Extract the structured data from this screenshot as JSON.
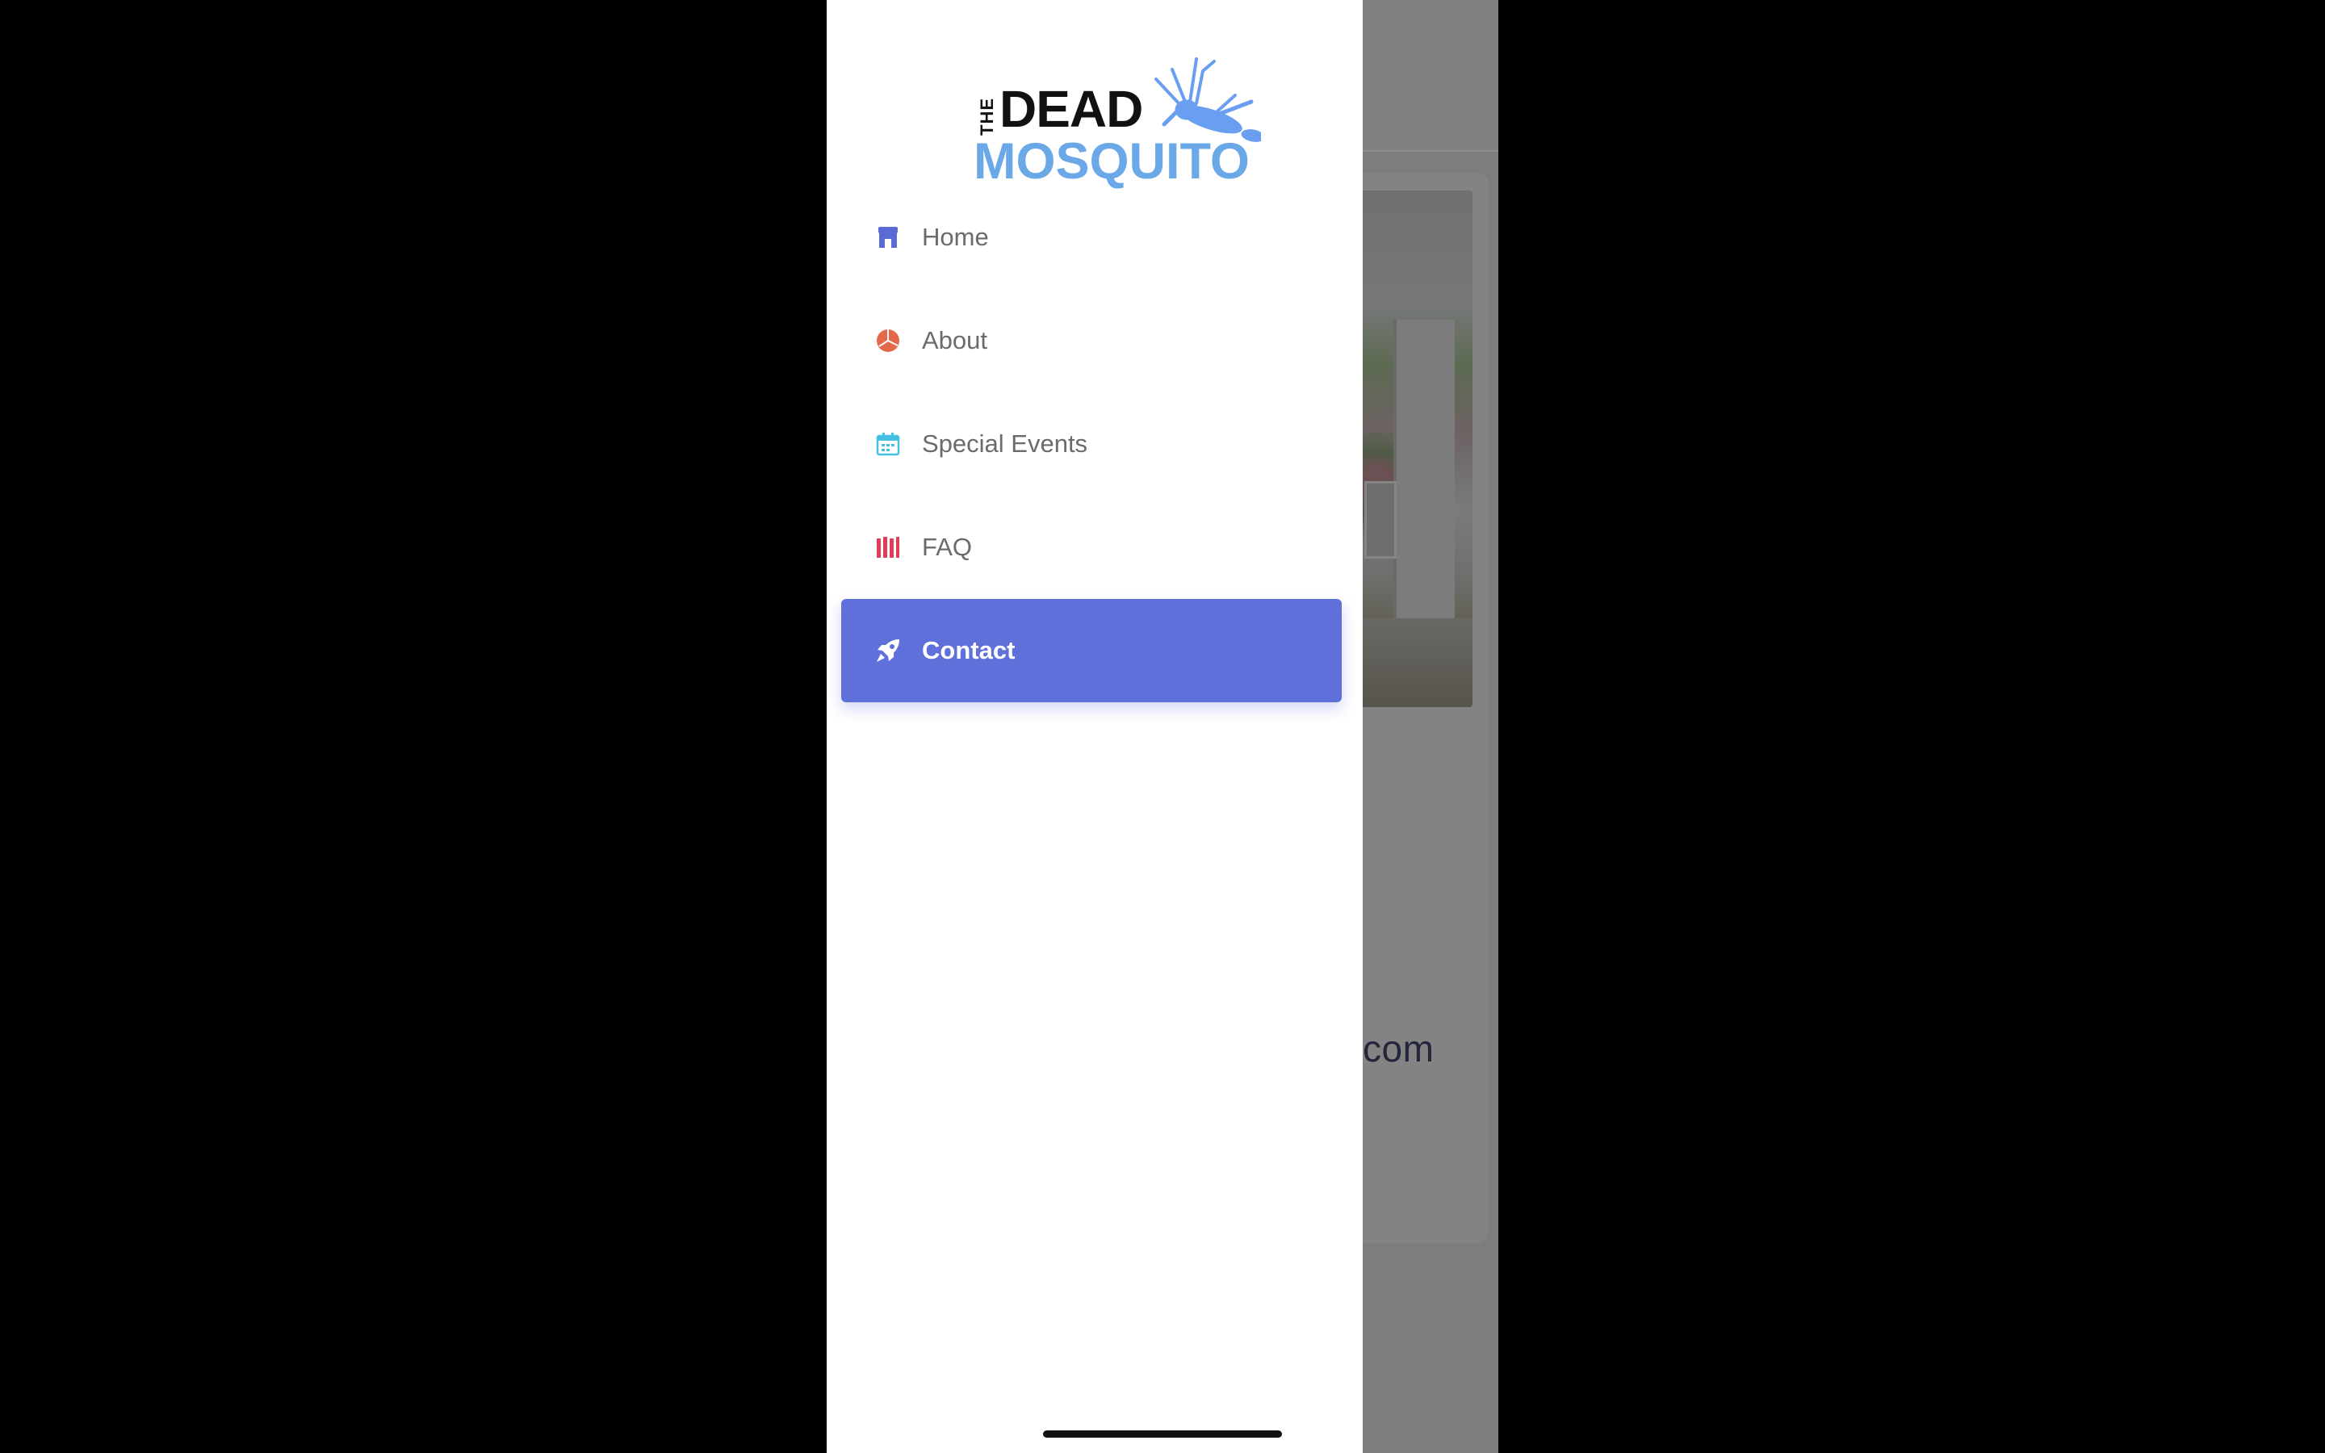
{
  "logo": {
    "the": "THE",
    "dead": "DEAD",
    "mosquito": "MOSQUITO"
  },
  "nav": {
    "items": [
      {
        "label": "Home",
        "icon": "store-icon",
        "color": "#5a6bd6"
      },
      {
        "label": "About",
        "icon": "pie-chart-icon",
        "color": "#e3694a"
      },
      {
        "label": "Special Events",
        "icon": "calendar-icon",
        "color": "#46c0e2"
      },
      {
        "label": "FAQ",
        "icon": "bars-icon",
        "color": "#e23d58"
      },
      {
        "label": "Contact",
        "icon": "rocket-icon",
        "color": "#ffffff",
        "active": true
      }
    ]
  },
  "background": {
    "partial_text": "com"
  },
  "colors": {
    "accent": "#6070da",
    "logo_blue": "#6aa8e8"
  }
}
